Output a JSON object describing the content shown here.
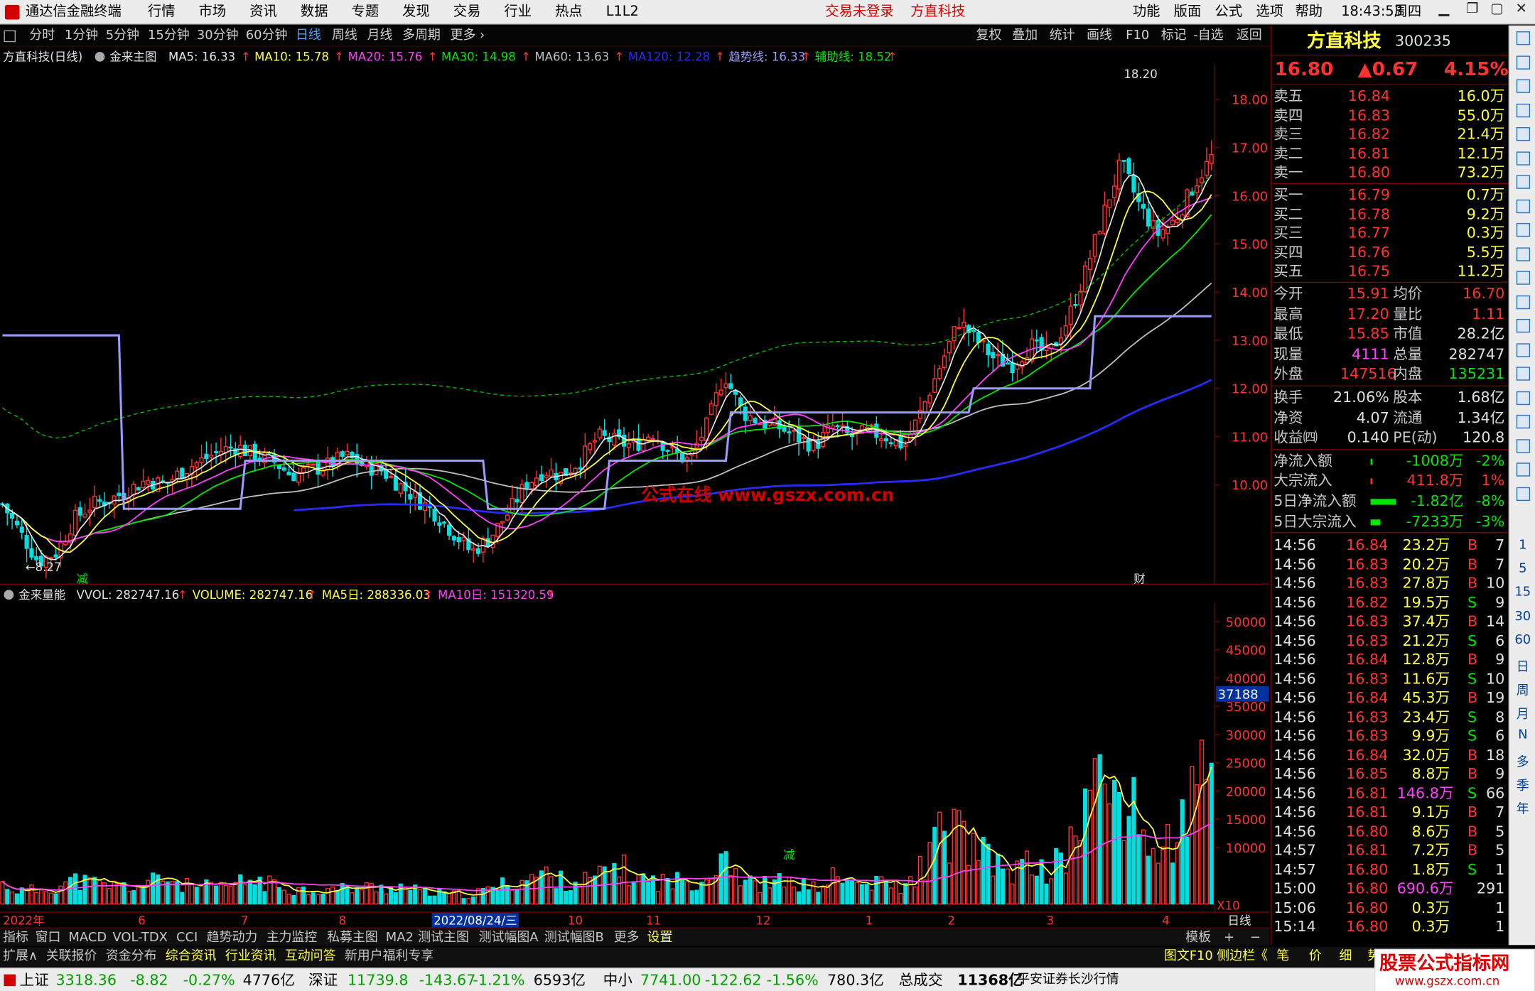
{
  "menubar": {
    "app_title": "通达信金融终端",
    "items": [
      "行情",
      "市场",
      "资讯",
      "数据",
      "专题",
      "发现",
      "交易",
      "行业",
      "热点",
      "L1L2"
    ],
    "login": "交易未登录",
    "stock": "方直科技",
    "right_items": [
      "功能",
      "版面",
      "公式",
      "选项",
      "帮助"
    ],
    "time": "18:43:53",
    "weekday": "周四"
  },
  "period_bar": {
    "items": [
      "分时",
      "1分钟",
      "5分钟",
      "15分钟",
      "30分钟",
      "60分钟",
      "日线",
      "周线",
      "月线",
      "多周期",
      "更多"
    ],
    "active": "日线",
    "right": [
      "复权",
      "叠加",
      "统计",
      "画线",
      "F10",
      "标记",
      "-自选",
      "返回"
    ]
  },
  "main_indicator": {
    "title": "方直科技(日线)",
    "formula": "金来主图",
    "values": [
      {
        "t": "MA5: 16.33",
        "c": "#e8e8e8"
      },
      {
        "t": "MA10: 15.78",
        "c": "#ffff40"
      },
      {
        "t": "MA20: 15.76",
        "c": "#ff40ff"
      },
      {
        "t": "MA30: 14.98",
        "c": "#00e600"
      },
      {
        "t": "MA60: 13.63",
        "c": "#c0c0c0"
      },
      {
        "t": "MA120: 12.28",
        "c": "#2a2aff"
      },
      {
        "t": "趋势线: 16.33",
        "c": "#9a9aff"
      },
      {
        "t": "辅助线: 18.52",
        "c": "#00e600"
      }
    ]
  },
  "vol_indicator": {
    "name": "金来量能",
    "values": [
      {
        "t": "VVOL: 282747.16",
        "c": "#e0e0e0"
      },
      {
        "t": "VOLUME: 282747.16",
        "c": "#ffff40"
      },
      {
        "t": "MA5日: 288336.03",
        "c": "#ffff40"
      },
      {
        "t": "MA10日: 151320.59",
        "c": "#ff40ff"
      }
    ]
  },
  "price_axis": [
    "18.00",
    "17.00",
    "16.00",
    "15.00",
    "14.00",
    "13.00",
    "12.00",
    "11.00",
    "10.00"
  ],
  "vol_axis": [
    "50000",
    "45000",
    "40000",
    "35000",
    "30000",
    "25000",
    "20000",
    "15000",
    "10000"
  ],
  "vol_axis_highlight": "37188",
  "vol_axis_unit": "X10",
  "chart_labels": {
    "high": "18.20",
    "low": "8.27",
    "mark_jian": "减",
    "mark_cai": "财",
    "mark_jian2": "减",
    "watermark": "公式在线  www.gszx.com.cn"
  },
  "date_axis": {
    "labels": [
      "2022年",
      "6",
      "7",
      "8",
      "9",
      "10",
      "11",
      "12",
      "1",
      "2",
      "3",
      "4"
    ],
    "cursor": "2022/08/24/三",
    "mode": "日线"
  },
  "quote": {
    "name": "方直科技",
    "code": "300235",
    "price": "16.80",
    "change": "▲0.67",
    "pct": "4.15%",
    "asks": [
      {
        "l": "卖五",
        "p": "16.84",
        "v": "16.0万"
      },
      {
        "l": "卖四",
        "p": "16.83",
        "v": "55.0万"
      },
      {
        "l": "卖三",
        "p": "16.82",
        "v": "21.4万"
      },
      {
        "l": "卖二",
        "p": "16.81",
        "v": "12.1万"
      },
      {
        "l": "卖一",
        "p": "16.80",
        "v": "73.2万"
      }
    ],
    "bids": [
      {
        "l": "买一",
        "p": "16.79",
        "v": "0.7万"
      },
      {
        "l": "买二",
        "p": "16.78",
        "v": "9.2万"
      },
      {
        "l": "买三",
        "p": "16.77",
        "v": "0.3万"
      },
      {
        "l": "买四",
        "p": "16.76",
        "v": "5.5万"
      },
      {
        "l": "买五",
        "p": "16.75",
        "v": "11.2万"
      }
    ],
    "stats": [
      {
        "a": "今开",
        "av": "15.91",
        "ac": "#ff3232",
        "b": "均价",
        "bv": "16.70",
        "bc": "#ff3232"
      },
      {
        "a": "最高",
        "av": "17.20",
        "ac": "#ff3232",
        "b": "量比",
        "bv": "1.11",
        "bc": "#ff3232"
      },
      {
        "a": "最低",
        "av": "15.85",
        "ac": "#ff3232",
        "b": "市值",
        "bv": "28.2亿",
        "bc": "#e0e0e0"
      },
      {
        "a": "现量",
        "av": "4111",
        "ac": "#ff40ff",
        "b": "总量",
        "bv": "282747",
        "bc": "#e0e0e0"
      },
      {
        "a": "外盘",
        "av": "147516",
        "ac": "#ff3232",
        "b": "内盘",
        "bv": "135231",
        "bc": "#00e600"
      }
    ],
    "stats2": [
      {
        "a": "换手",
        "av": "21.06%",
        "b": "股本",
        "bv": "1.68亿"
      },
      {
        "a": "净资",
        "av": "4.07",
        "b": "流通",
        "bv": "1.34亿"
      },
      {
        "a": "收益㈣",
        "av": "0.140",
        "b": "PE(动)",
        "bv": "120.8"
      }
    ],
    "flows": [
      {
        "l": "净流入额",
        "v": "-1008万",
        "p": "-2%",
        "c": "#00e600",
        "bar": "#00e600",
        "w": 2
      },
      {
        "l": "大宗流入",
        "v": "411.8万",
        "p": "1%",
        "c": "#ff3232",
        "bar": "#ff3232",
        "w": 2
      },
      {
        "l": "5日净流入额",
        "v": "-1.82亿",
        "p": "-8%",
        "c": "#00e600",
        "bar": "#00e600",
        "w": 26
      },
      {
        "l": "5日大宗流入",
        "v": "-7233万",
        "p": "-3%",
        "c": "#00e600",
        "bar": "#00e600",
        "w": 10
      }
    ],
    "ticks": [
      {
        "t": "14:56",
        "p": "16.84",
        "v": "23.2万",
        "s": "B",
        "n": "7"
      },
      {
        "t": "14:56",
        "p": "16.83",
        "v": "20.2万",
        "s": "B",
        "n": "7"
      },
      {
        "t": "14:56",
        "p": "16.83",
        "v": "27.8万",
        "s": "B",
        "n": "10"
      },
      {
        "t": "14:56",
        "p": "16.82",
        "v": "19.5万",
        "s": "S",
        "n": "9"
      },
      {
        "t": "14:56",
        "p": "16.83",
        "v": "37.4万",
        "s": "B",
        "n": "14"
      },
      {
        "t": "14:56",
        "p": "16.83",
        "v": "21.2万",
        "s": "S",
        "n": "6"
      },
      {
        "t": "14:56",
        "p": "16.84",
        "v": "12.8万",
        "s": "B",
        "n": "9"
      },
      {
        "t": "14:56",
        "p": "16.83",
        "v": "11.6万",
        "s": "S",
        "n": "10"
      },
      {
        "t": "14:56",
        "p": "16.84",
        "v": "45.3万",
        "s": "B",
        "n": "19"
      },
      {
        "t": "14:56",
        "p": "16.83",
        "v": "23.4万",
        "s": "S",
        "n": "8"
      },
      {
        "t": "14:56",
        "p": "16.83",
        "v": "9.9万",
        "s": "S",
        "n": "6"
      },
      {
        "t": "14:56",
        "p": "16.84",
        "v": "32.0万",
        "s": "B",
        "n": "18"
      },
      {
        "t": "14:56",
        "p": "16.85",
        "v": "8.8万",
        "s": "B",
        "n": "9"
      },
      {
        "t": "14:56",
        "p": "16.81",
        "v": "146.8万",
        "s": "S",
        "n": "66"
      },
      {
        "t": "14:56",
        "p": "16.81",
        "v": "9.1万",
        "s": "B",
        "n": "7"
      },
      {
        "t": "14:56",
        "p": "16.80",
        "v": "8.6万",
        "s": "B",
        "n": "5"
      },
      {
        "t": "14:57",
        "p": "16.81",
        "v": "7.2万",
        "s": "B",
        "n": "5"
      },
      {
        "t": "14:57",
        "p": "16.80",
        "v": "1.8万",
        "s": "S",
        "n": "1"
      },
      {
        "t": "15:00",
        "p": "16.80",
        "v": "690.6万",
        "s": "",
        "n": "291"
      },
      {
        "t": "15:06",
        "p": "16.80",
        "v": "0.3万",
        "s": "",
        "n": "1"
      },
      {
        "t": "15:14",
        "p": "16.80",
        "v": "0.3万",
        "s": "",
        "n": "1"
      }
    ]
  },
  "right_toolbar": [
    "1",
    "5",
    "15",
    "30",
    "60",
    "日",
    "周",
    "月",
    "N",
    "多",
    "季",
    "年"
  ],
  "tabs_row1": [
    "指标",
    "窗口",
    "MACD",
    "VOL-TDX",
    "CCI",
    "趋势动力",
    "主力监控",
    "私募主图",
    "MA2",
    "测试主图",
    "测试幅图A",
    "测试幅图B",
    "更多",
    "设置"
  ],
  "tabs_row1_right": [
    "模板",
    "+",
    "−"
  ],
  "tabs_row2": [
    "扩展∧",
    "关联报价",
    "资金分布",
    "综合资讯",
    "行业资讯",
    "互动问答",
    "新用户福利专享"
  ],
  "tabs_row2_right": [
    "图文F10",
    "侧边栏《",
    "笔",
    "价",
    "细",
    "势"
  ],
  "status": {
    "idx": [
      {
        "n": "上证",
        "v": "3318.36",
        "c": "-8.82",
        "p": "-0.27%",
        "a": "4776亿"
      },
      {
        "n": "深证",
        "v": "11739.8",
        "c": "-143.67",
        "p": "-1.21%",
        "a": "6593亿"
      },
      {
        "n": "中小",
        "v": "7741.00",
        "c": "-122.62",
        "p": "-1.56%",
        "a": "780.3亿"
      }
    ],
    "total_label": "总成交",
    "total": "11368亿",
    "broker": "平安证券长沙行情",
    "logo_text": "股票公式指标网",
    "logo_url": "www.gszx.com.cn"
  },
  "colors": {
    "up": "#ff3232",
    "down": "#00e0e0",
    "ma5": "#e8e8e8",
    "ma10": "#ffff40",
    "ma20": "#ff40ff",
    "ma30": "#00e600",
    "ma60": "#c0c0c0",
    "ma120": "#2a2aff",
    "trend": "#9a9aff"
  },
  "chart_data": {
    "type": "candlestick",
    "title": "方直科技(日线)",
    "ylim": [
      8.0,
      18.6
    ],
    "key_values": {
      "high": 18.2,
      "low": 8.27,
      "last_close": 16.8
    },
    "price_path": [
      9.6,
      9.0,
      8.4,
      8.6,
      9.3,
      9.6,
      9.7,
      9.9,
      10.1,
      10.0,
      10.3,
      10.5,
      10.7,
      10.8,
      10.6,
      10.5,
      10.2,
      10.3,
      10.4,
      10.6,
      10.4,
      10.3,
      10.0,
      9.7,
      9.4,
      9.0,
      8.6,
      8.9,
      9.4,
      10.0,
      10.3,
      10.2,
      10.5,
      11.0,
      10.9,
      10.8,
      11.1,
      10.7,
      10.5,
      11.2,
      12.3,
      11.5,
      11.3,
      11.2,
      11.0,
      10.8,
      11.2,
      11.0,
      11.1,
      11.0,
      10.8,
      11.6,
      12.5,
      13.4,
      13.0,
      12.6,
      12.5,
      12.9,
      12.7,
      13.4,
      14.4,
      15.6,
      16.7,
      15.8,
      15.2,
      15.5,
      16.2,
      16.8
    ],
    "vol_path": [
      3500,
      2200,
      2500,
      3100,
      4100,
      3600,
      3300,
      3000,
      3500,
      4800,
      3200,
      3000,
      2800,
      3600,
      4200,
      3300,
      2700,
      2400,
      2500,
      2700,
      2900,
      2800,
      3100,
      2300,
      1800,
      1700,
      1600,
      2600,
      3600,
      4300,
      5300,
      4000,
      4000,
      4500,
      7000,
      4700,
      4000,
      4000,
      4000,
      4500,
      10000,
      3800,
      3400,
      3800,
      3600,
      2700,
      4600,
      3700,
      3200,
      3800,
      2600,
      6800,
      12000,
      13000,
      9000,
      6800,
      5700,
      7000,
      5600,
      8800,
      18000,
      21500,
      19000,
      14000,
      8500,
      12000,
      18800,
      23000
    ],
    "vol_ylim": [
      0,
      53000
    ]
  }
}
